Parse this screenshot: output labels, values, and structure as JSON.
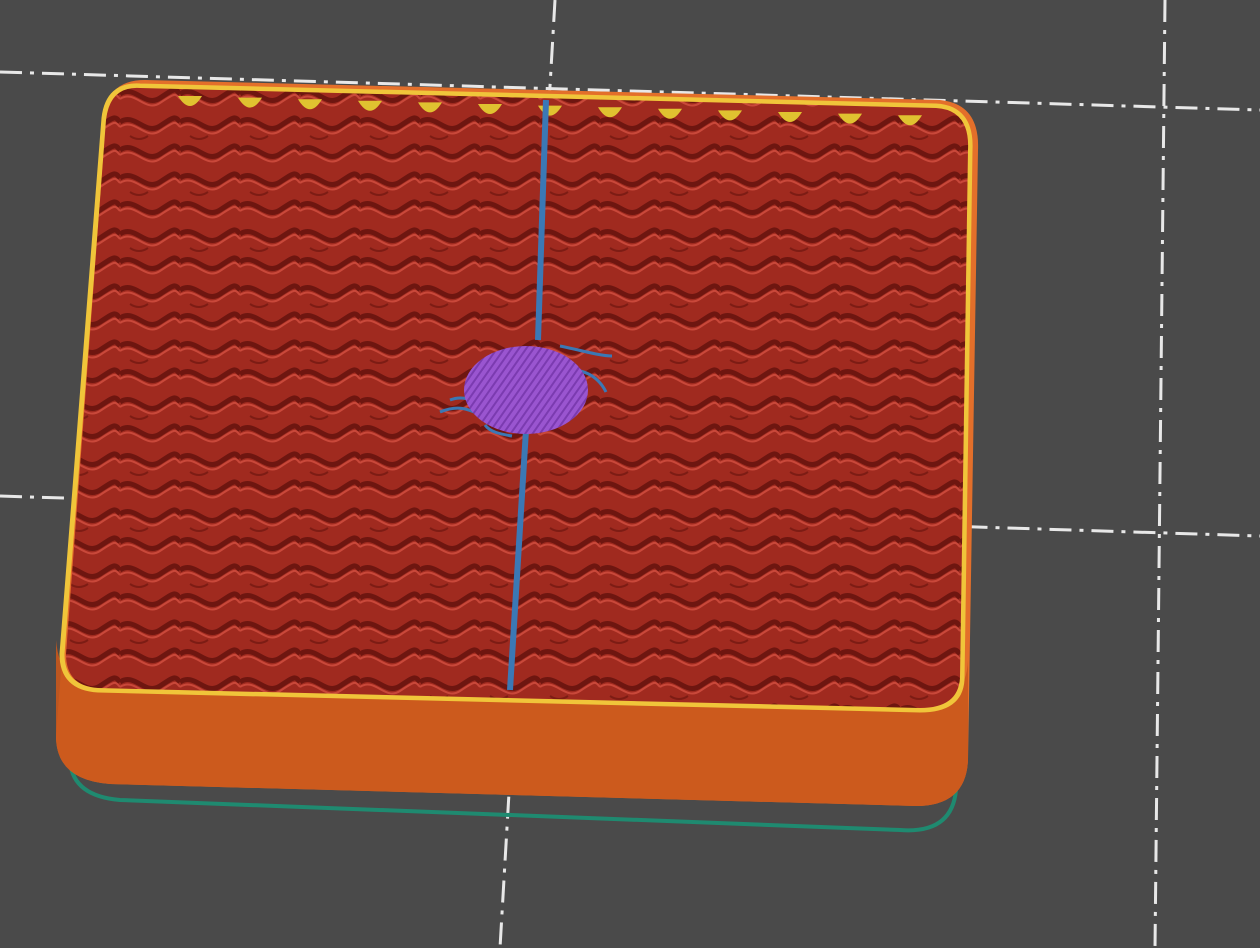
{
  "app": "slicer-3d-preview",
  "viewport": {
    "background": "#4a4a4a",
    "bed_gridline_color": "#e8e8e8"
  },
  "object": {
    "kind": "sliced-square-box-preview",
    "colors": {
      "external_perimeter": "#e36f2a",
      "outer_wall_shade": "#c9581c",
      "perimeter": "#f0c53a",
      "internal_infill": "#a02a1f",
      "infill_dark": "#6e1610",
      "infill_light": "#c9483a",
      "support_material": "#3b78b5",
      "top_solid_infill": "#9a55d0",
      "skirt": "#1f8a70",
      "overhang_marks": "#e0c230"
    }
  }
}
